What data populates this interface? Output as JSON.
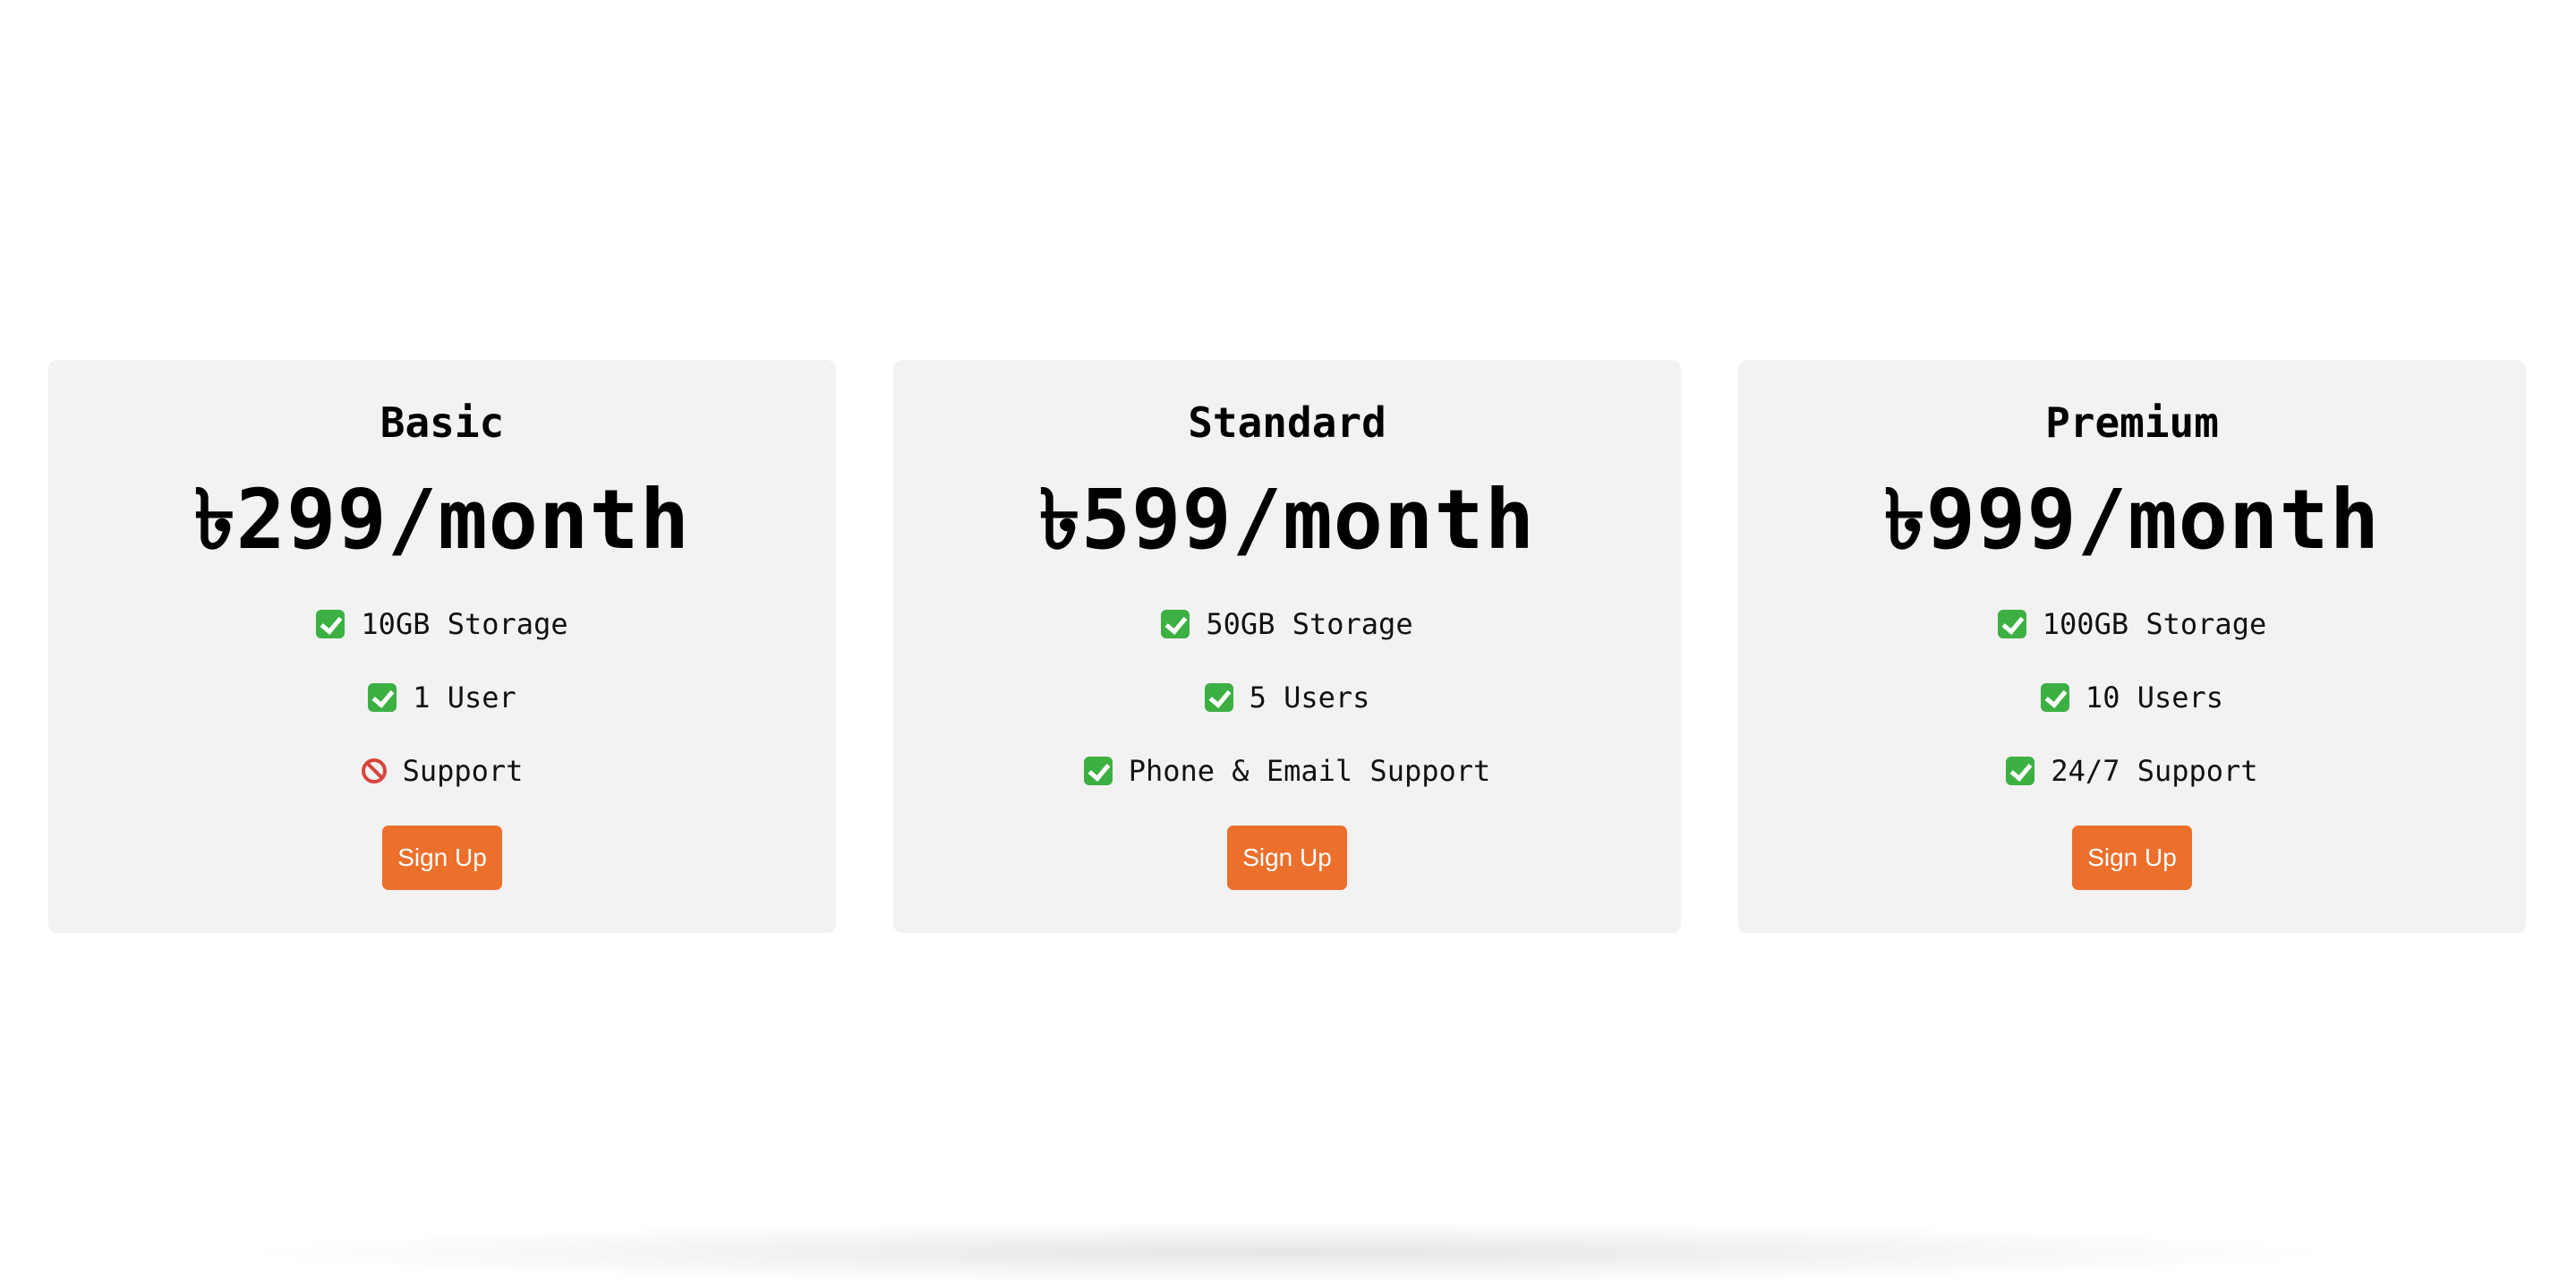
{
  "plans": [
    {
      "name": "Basic",
      "price": "৳299/month",
      "features": [
        {
          "icon": "check-icon",
          "text": "10GB Storage"
        },
        {
          "icon": "check-icon",
          "text": "1 User"
        },
        {
          "icon": "prohibited-icon",
          "text": "Support"
        }
      ],
      "button_label": "Sign Up"
    },
    {
      "name": "Standard",
      "price": "৳599/month",
      "features": [
        {
          "icon": "check-icon",
          "text": "50GB Storage"
        },
        {
          "icon": "check-icon",
          "text": "5 Users"
        },
        {
          "icon": "check-icon",
          "text": "Phone & Email Support"
        }
      ],
      "button_label": "Sign Up"
    },
    {
      "name": "Premium",
      "price": "৳999/month",
      "features": [
        {
          "icon": "check-icon",
          "text": "100GB Storage"
        },
        {
          "icon": "check-icon",
          "text": "10 Users"
        },
        {
          "icon": "check-icon",
          "text": "24/7 Support"
        }
      ],
      "button_label": "Sign Up"
    }
  ],
  "colors": {
    "card_background": "#f2f2f2",
    "button": "#ec6f2c",
    "button_text": "#ffffff",
    "check": "#3cb043",
    "prohibited": "#d9443d"
  }
}
